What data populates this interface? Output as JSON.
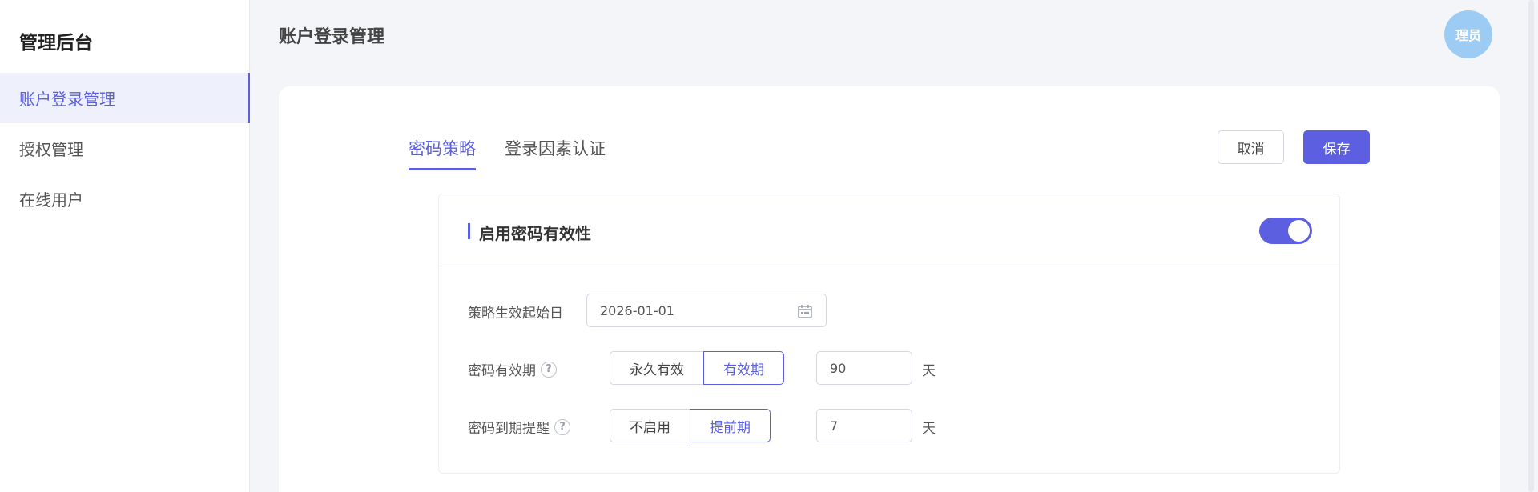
{
  "sidebar": {
    "title": "管理后台",
    "items": [
      {
        "label": "账户登录管理"
      },
      {
        "label": "授权管理"
      },
      {
        "label": "在线用户"
      }
    ]
  },
  "header": {
    "title": "账户登录管理",
    "avatar_text": "理员"
  },
  "tabs": [
    {
      "label": "密码策略"
    },
    {
      "label": "登录因素认证"
    }
  ],
  "actions": {
    "cancel": "取消",
    "save": "保存"
  },
  "panel": {
    "title": "启用密码有效性",
    "toggle_on": true,
    "start_date": {
      "label": "策略生效起始日",
      "value": "2026-01-01"
    },
    "validity": {
      "label": "密码有效期",
      "options": [
        "永久有效",
        "有效期"
      ],
      "selected": "有效期",
      "value": "90",
      "unit": "天"
    },
    "reminder": {
      "label": "密码到期提醒",
      "options": [
        "不启用",
        "提前期"
      ],
      "selected": "提前期",
      "value": "7",
      "unit": "天"
    }
  },
  "colors": {
    "accent": "#5b5fe0",
    "avatar": "#9ccbf3",
    "background": "#f4f5f8"
  }
}
